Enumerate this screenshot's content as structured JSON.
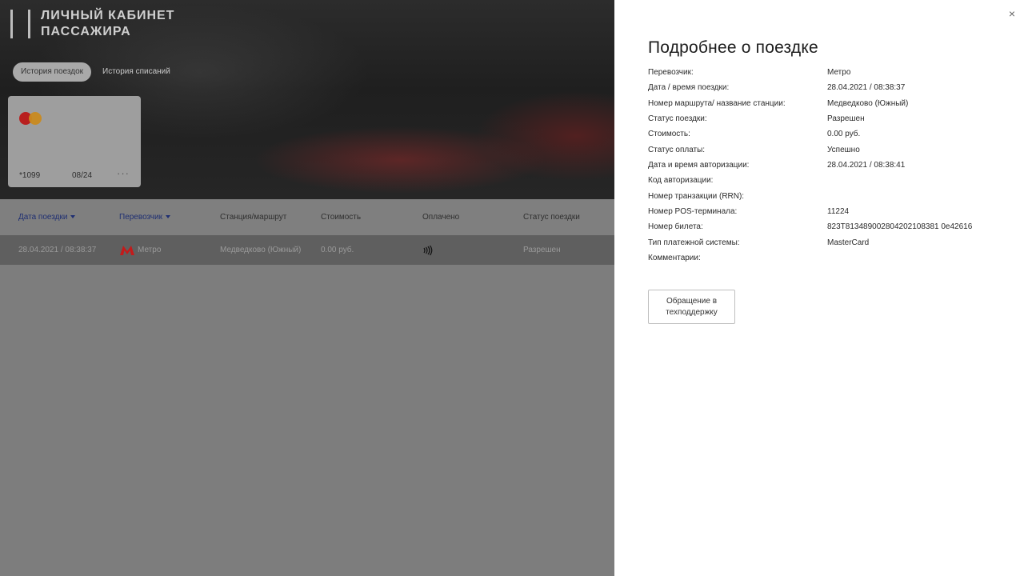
{
  "header": {
    "logo_line1": "ЛИЧНЫЙ КАБИНЕТ",
    "logo_line2": "ПАССАЖИРА"
  },
  "tabs": [
    {
      "label": "История поездок",
      "active": true
    },
    {
      "label": "История списаний",
      "active": false
    }
  ],
  "card": {
    "brand": "MasterCard",
    "number": "*1099",
    "expiry": "08/24",
    "more": "···"
  },
  "table": {
    "columns": [
      "Дата поездки",
      "Перевозчик",
      "Станция/маршрут",
      "Стоимость",
      "Оплачено",
      "Статус поездки"
    ],
    "rows": [
      {
        "date": "28.04.2021 / 08:38:37",
        "carrier": "Метро",
        "station": "Медведково (Южный)",
        "cost": "0.00  руб.",
        "paid_icon": "contactless-icon",
        "status": "Разрешен"
      }
    ]
  },
  "modal": {
    "title": "Подробнее о поездке",
    "close": "×",
    "details": [
      {
        "label": "Перевозчик:",
        "value": "Метро"
      },
      {
        "label": "Дата / время поездки:",
        "value": "28.04.2021 / 08:38:37"
      },
      {
        "label": "Номер маршрута/ название станции:",
        "value": "Медведково (Южный)"
      },
      {
        "label": "Статус поездки:",
        "value": "Разрешен"
      },
      {
        "label": "Стоимость:",
        "value": "0.00  руб."
      },
      {
        "label": "Статус оплаты:",
        "value": "Успешно"
      },
      {
        "label": "Дата и время авторизации:",
        "value": "28.04.2021 / 08:38:41"
      },
      {
        "label": "Код авторизации:",
        "value": ""
      },
      {
        "label": "Номер транзакции (RRN):",
        "value": ""
      },
      {
        "label": "Номер POS-терминала:",
        "value": "11224"
      },
      {
        "label": "Номер билета:",
        "value": "823T813489002804202108381 0e42616"
      },
      {
        "label": "Тип платежной системы:",
        "value": "MasterCard"
      },
      {
        "label": "Комментарии:",
        "value": ""
      }
    ],
    "support_button": "Обращение в техподдержку"
  },
  "colors": {
    "accent_blue": "#1f2f72",
    "metro_red": "#c41a1a",
    "overlay_gray": "#7d7d7d"
  }
}
